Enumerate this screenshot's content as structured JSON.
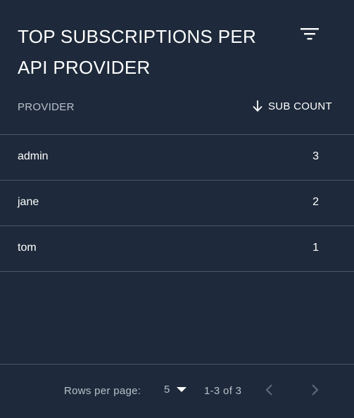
{
  "title": "TOP SUBSCRIPTIONS PER API PROVIDER",
  "filter_icon": "filter-list-icon",
  "table": {
    "columns": {
      "provider": "PROVIDER",
      "count": "SUB COUNT",
      "sort_icon": "arrow-down-icon"
    },
    "rows": [
      {
        "provider": "admin",
        "count": "3"
      },
      {
        "provider": "jane",
        "count": "2"
      },
      {
        "provider": "tom",
        "count": "1"
      }
    ]
  },
  "pagination": {
    "rows_per_page_label": "Rows per page:",
    "rows_per_page_value": "5",
    "range": "1-3 of 3",
    "prev_icon": "chevron-left-icon",
    "next_icon": "chevron-right-icon"
  },
  "colors": {
    "background": "#1e2a3b",
    "divider": "#4a5566",
    "muted_text": "#b9c0ca",
    "text": "#ffffff"
  }
}
